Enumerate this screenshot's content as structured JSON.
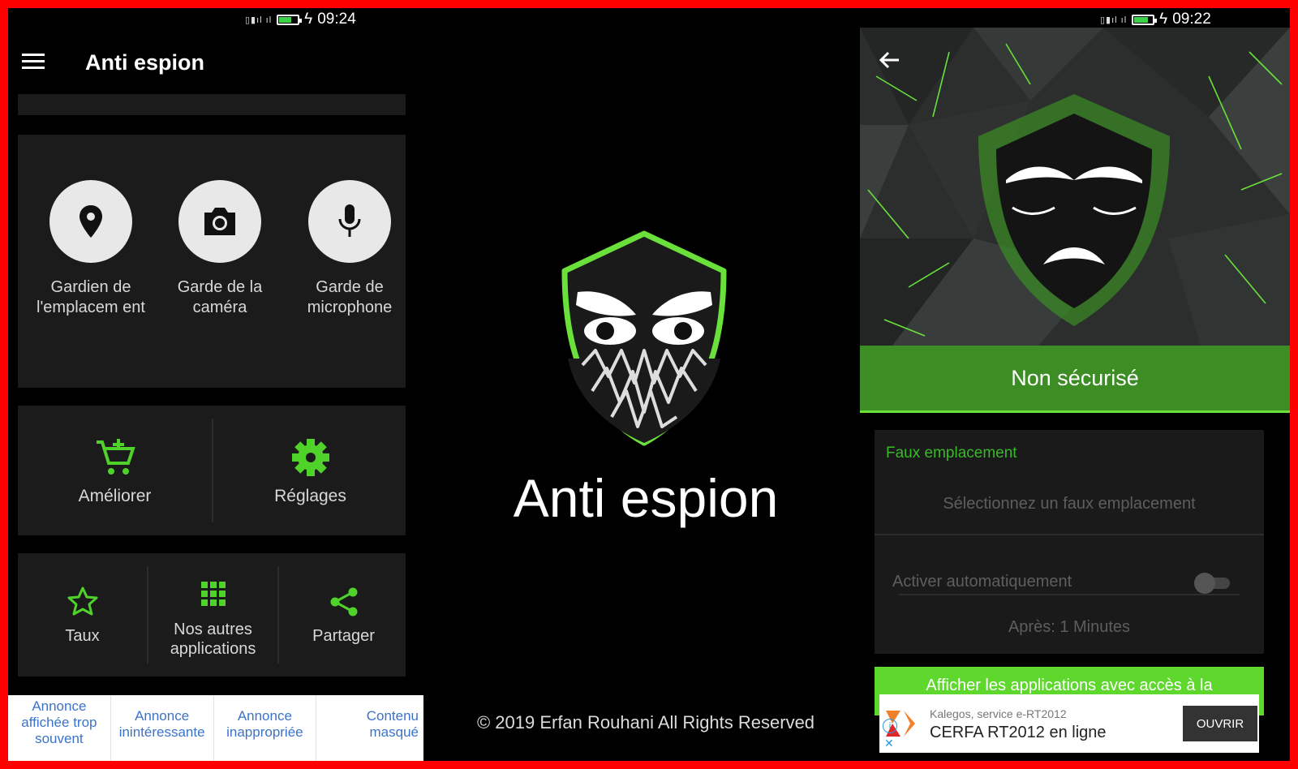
{
  "left": {
    "status_time": "09:24",
    "title": "Anti espion",
    "guards": [
      {
        "label": "Gardien de l'emplacem ent",
        "icon": "location-pin-icon"
      },
      {
        "label": "Garde de la caméra",
        "icon": "camera-icon"
      },
      {
        "label": "Garde de microphone",
        "icon": "microphone-icon"
      }
    ],
    "improve_label": "Améliorer",
    "settings_label": "Réglages",
    "rate_label": "Taux",
    "other_apps_label": "Nos autres applications",
    "share_label": "Partager",
    "ads": [
      "Annonce affichée trop souvent",
      "Annonce inintéressante",
      "Annonce inappropriée",
      "Contenu masqué"
    ]
  },
  "middle": {
    "title": "Anti espion",
    "copyright": "© 2019 Erfan Rouhani All Rights Reserved"
  },
  "right": {
    "status_time": "09:22",
    "status_text": "Non sécurisé",
    "section_title": "Faux emplacement",
    "select_placeholder": "Sélectionnez un faux emplacement",
    "auto_label": "Activer automatiquement",
    "after_label": "Après: 1 Minutes",
    "button_label": "Afficher les applications avec accès à la",
    "ad": {
      "advertiser": "Kalegos, service e-RT2012",
      "headline": "CERFA RT2012 en ligne",
      "cta": "OUVRIR"
    }
  },
  "colors": {
    "accent_green": "#5fd82e",
    "dark_green": "#3b8d24",
    "frame_red": "#ff0000",
    "link_blue": "#3c73c7"
  }
}
